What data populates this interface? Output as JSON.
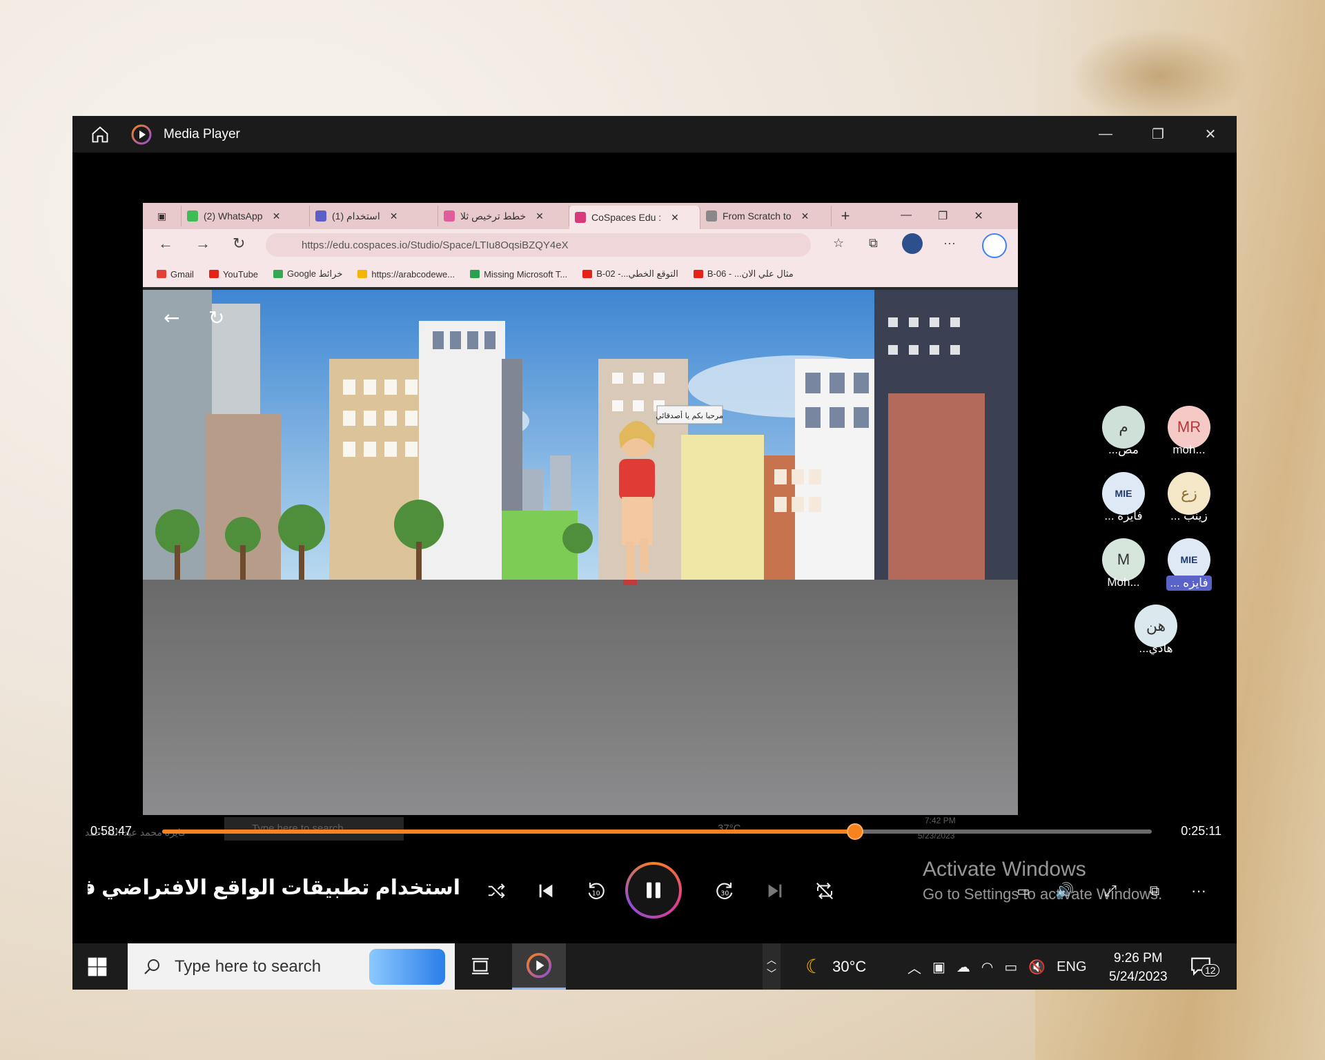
{
  "window": {
    "app_title": "Media Player"
  },
  "video": {
    "browser": {
      "tabs": [
        {
          "label": "(2) WhatsApp",
          "color": "#3fbb55",
          "active": false
        },
        {
          "label": "(1) استخدام",
          "color": "#5b5fc7",
          "active": false
        },
        {
          "label": "خطط ترخيص ثلا",
          "color": "#e05c9a",
          "active": false
        },
        {
          "label": "CoSpaces Edu :",
          "color": "#d9397a",
          "active": true
        },
        {
          "label": "From Scratch to",
          "color": "#888888",
          "active": false
        }
      ],
      "address": "https://edu.cospaces.io/Studio/Space/LTIu8OqsiBZQY4eX",
      "bookmarks": [
        {
          "label": "Gmail",
          "color": "#e34133"
        },
        {
          "label": "YouTube",
          "color": "#e62117"
        },
        {
          "label": "Google خرائط",
          "color": "#34a853"
        },
        {
          "label": "https://arabcodewe...",
          "color": "#f5b400"
        },
        {
          "label": "Missing Microsoft T...",
          "color": "#2aa14f"
        },
        {
          "label": "B-02 -...التوقع الخطي",
          "color": "#e62117"
        },
        {
          "label": "B-06 - ...مثال علي الان",
          "color": "#e62117"
        }
      ]
    },
    "speech_bubble": "مرحبا بكم يا أصدقائي",
    "ghost_taskbar": {
      "author": "فايزه محمد عبد الله احمد",
      "search": "Type here to search",
      "temp": "37°C",
      "time": "7:42 PM",
      "date": "5/23/2023"
    }
  },
  "participants": [
    {
      "initials": "م",
      "name": "...مص",
      "color": "#cfe0d8",
      "highlight": false
    },
    {
      "initials": "MR",
      "name": "moh...",
      "color": "#f4c9c6",
      "highlight": false
    },
    {
      "initials": "MIE",
      "name": "... فايزه",
      "color": "#dfe8f5",
      "highlight": false
    },
    {
      "initials": "زع",
      "name": "... زينب",
      "color": "#f3e7c8",
      "highlight": false
    },
    {
      "initials": "M",
      "name": "Moh...",
      "color": "#d6e6dc",
      "highlight": false
    },
    {
      "initials": "MIE",
      "name": "... فايزه",
      "color": "#dfe8f5",
      "highlight": true
    },
    {
      "initials": "هن",
      "name": "...هادي",
      "color": "#dbe8ee",
      "highlight": false
    }
  ],
  "player": {
    "elapsed": "0:58:47",
    "remaining": "0:25:11",
    "progress": 0.7,
    "now_playing": "استخدام تطبيقات الواقع الافتراضي ف...",
    "accent": "#f7821e"
  },
  "watermark": {
    "line1": "Activate Windows",
    "line2": "Go to Settings to activate Windows."
  },
  "taskbar": {
    "search_placeholder": "Type here to search",
    "temperature": "30°C",
    "language": "ENG",
    "time": "9:26 PM",
    "date": "5/24/2023",
    "notifications": "12"
  }
}
